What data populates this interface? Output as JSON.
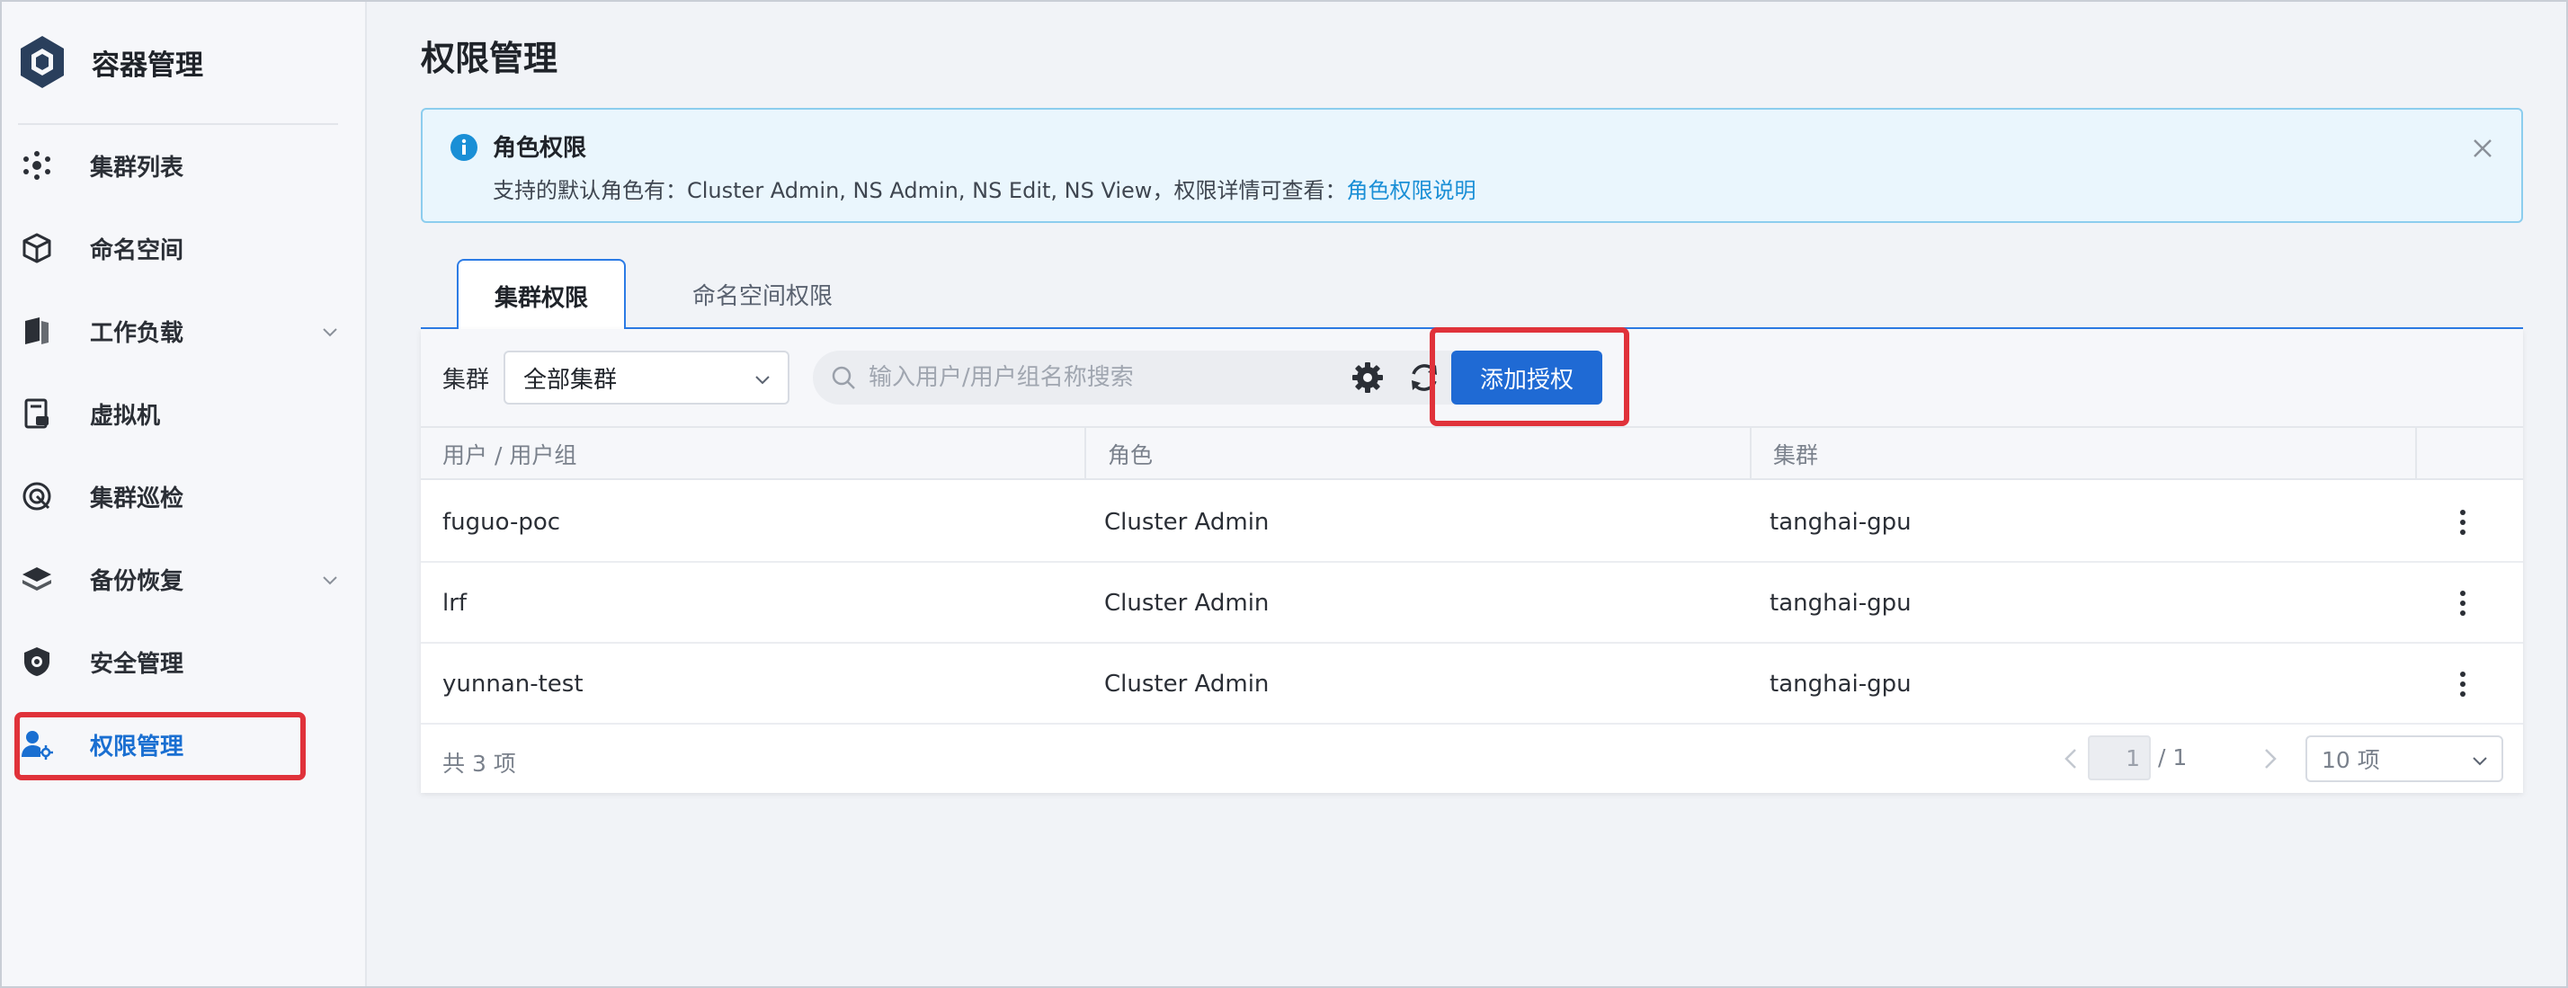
{
  "app": {
    "title": "容器管理"
  },
  "sidebar": {
    "items": [
      {
        "label": "集群列表",
        "icon": "cluster-icon"
      },
      {
        "label": "命名空间",
        "icon": "cube-icon"
      },
      {
        "label": "工作负载",
        "icon": "workload-icon",
        "expandable": true
      },
      {
        "label": "虚拟机",
        "icon": "vm-icon"
      },
      {
        "label": "集群巡检",
        "icon": "inspection-icon"
      },
      {
        "label": "备份恢复",
        "icon": "backup-icon",
        "expandable": true
      },
      {
        "label": "安全管理",
        "icon": "shield-icon"
      },
      {
        "label": "权限管理",
        "icon": "user-settings-icon",
        "active": true
      }
    ]
  },
  "page": {
    "title": "权限管理"
  },
  "alert": {
    "title": "角色权限",
    "text": "支持的默认角色有：Cluster Admin, NS Admin, NS Edit, NS View，权限详情可查看：",
    "link": "角色权限说明"
  },
  "tabs": [
    {
      "label": "集群权限",
      "active": true
    },
    {
      "label": "命名空间权限",
      "active": false
    }
  ],
  "toolbar": {
    "filter_label": "集群",
    "cluster_select_value": "全部集群",
    "search_placeholder": "输入用户/用户组名称搜索",
    "add_button": "添加授权"
  },
  "table": {
    "columns": [
      "用户 / 用户组",
      "角色",
      "集群",
      ""
    ],
    "rows": [
      {
        "user": "fuguo-poc",
        "role": "Cluster Admin",
        "cluster": "tanghai-gpu"
      },
      {
        "user": "lrf",
        "role": "Cluster Admin",
        "cluster": "tanghai-gpu"
      },
      {
        "user": "yunnan-test",
        "role": "Cluster Admin",
        "cluster": "tanghai-gpu"
      }
    ]
  },
  "pagination": {
    "total": "共 3 项",
    "current_page": "1",
    "total_pages": "/ 1",
    "page_size": "10 项"
  },
  "colors": {
    "accent": "#1f6ad4",
    "active_nav": "#1a6fd1",
    "highlight": "#e0323a",
    "alert_bg": "#eaf6fd",
    "alert_border": "#8ccdee",
    "link": "#1a8fd6"
  }
}
